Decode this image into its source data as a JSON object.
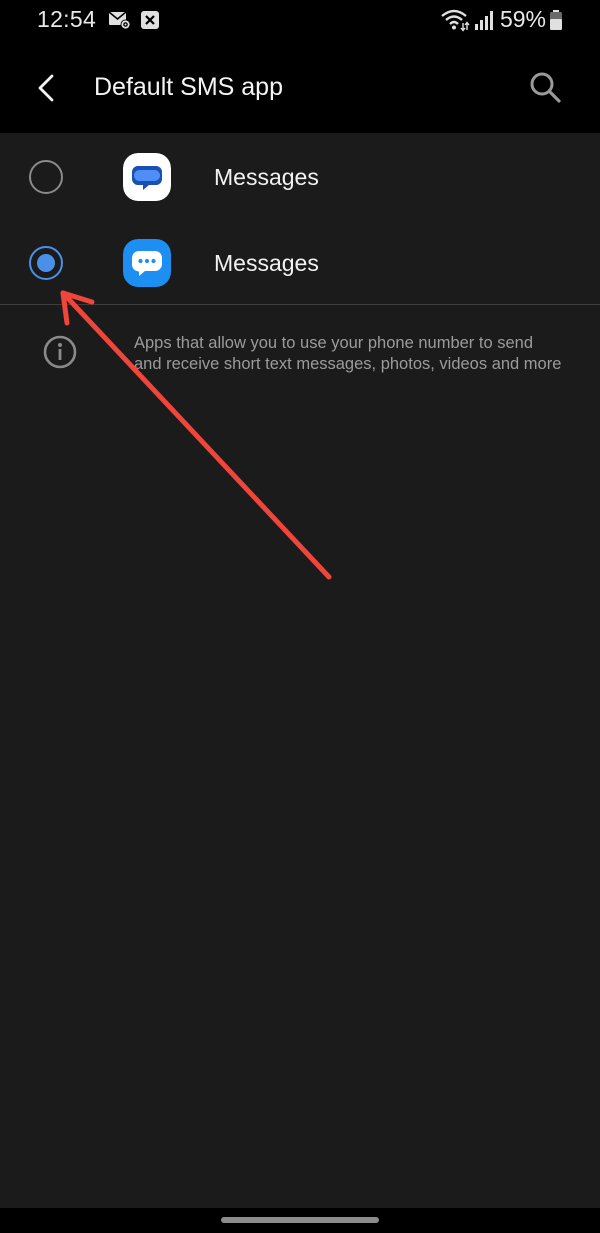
{
  "status_bar": {
    "time": "12:54",
    "battery": "59%",
    "icons": [
      "sms-settings-icon",
      "close-box-icon",
      "wifi-icon",
      "signal-icon",
      "battery-icon"
    ]
  },
  "app_bar": {
    "title": "Default SMS app",
    "back_icon": "back-arrow-icon",
    "search_icon": "search-icon"
  },
  "apps": [
    {
      "label": "Messages",
      "icon": "google-messages-icon",
      "selected": false
    },
    {
      "label": "Messages",
      "icon": "samsung-messages-icon",
      "selected": true
    }
  ],
  "info": {
    "icon": "info-icon",
    "text": "Apps that allow you to use your phone number to send and receive short text messages, photos, videos and more"
  },
  "colors": {
    "accent": "#4a90e8",
    "background": "#1b1b1b",
    "annotation_arrow": "#f0453a"
  }
}
